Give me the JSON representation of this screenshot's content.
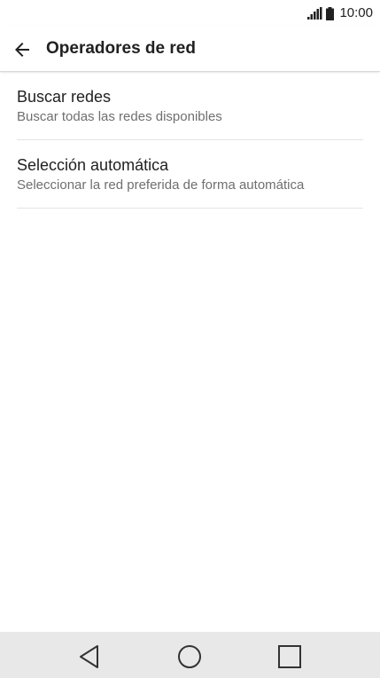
{
  "status_bar": {
    "time": "10:00",
    "icons": [
      "signal-icon",
      "battery-icon"
    ]
  },
  "app_bar": {
    "back_icon": "arrow-left-icon",
    "title": "Operadores de red"
  },
  "list": {
    "items": [
      {
        "title": "Buscar redes",
        "subtitle": "Buscar todas las redes disponibles"
      },
      {
        "title": "Selección automática",
        "subtitle": "Seleccionar la red preferida de forma automática"
      }
    ]
  },
  "nav_bar": {
    "icons": [
      "nav-back-icon",
      "nav-home-icon",
      "nav-recent-apps-icon"
    ]
  },
  "colors": {
    "text_primary": "#212121",
    "text_secondary": "#6f6f6f",
    "nav_background": "#e8e8e8",
    "divider": "#e3e3e3"
  }
}
